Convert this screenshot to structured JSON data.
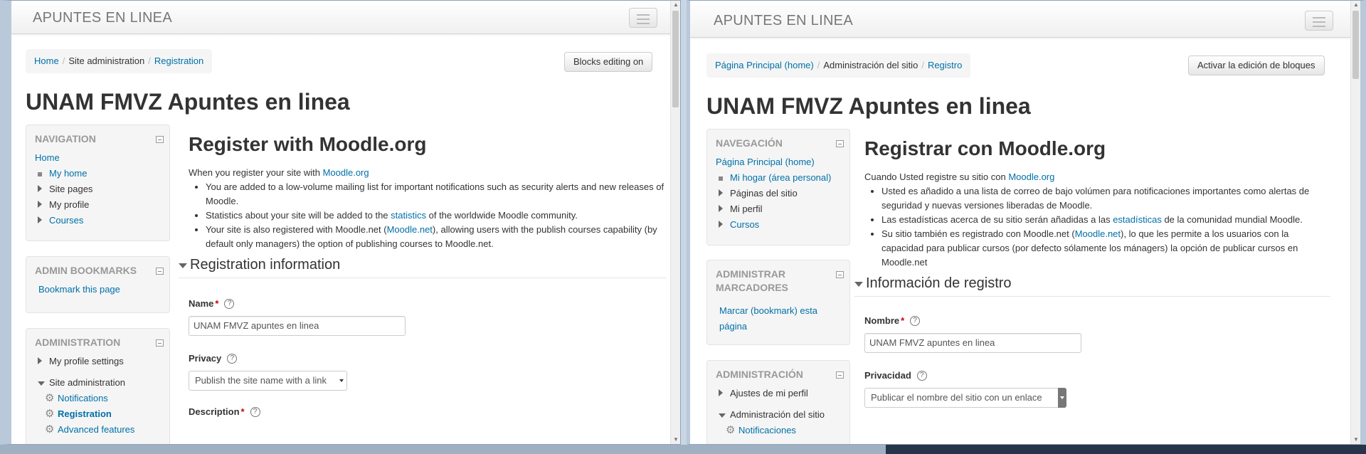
{
  "left": {
    "brand": "APUNTES EN LINEA",
    "breadcrumb": [
      "Home",
      "Site administration",
      "Registration"
    ],
    "edit_button": "Blocks editing on",
    "site_title": "UNAM FMVZ Apuntes en linea",
    "navigation": {
      "title": "NAVIGATION",
      "home": "Home",
      "items": [
        "My home",
        "Site pages",
        "My profile",
        "Courses"
      ]
    },
    "bookmarks": {
      "title": "ADMIN BOOKMARKS",
      "link": "Bookmark this page"
    },
    "administration": {
      "title": "ADMINISTRATION",
      "profile_settings": "My profile settings",
      "site_admin": "Site administration",
      "sub": [
        "Notifications",
        "Registration",
        "Advanced features"
      ]
    },
    "main": {
      "heading": "Register with Moodle.org",
      "intro_prefix": "When you register your site with ",
      "intro_link": "Moodle.org",
      "b1": "You are added to a low-volume mailing list for important notifications such as security alerts and new releases of Moodle.",
      "b2_pre": "Statistics about your site will be added to the ",
      "b2_link": "statistics",
      "b2_post": " of the worldwide Moodle community.",
      "b3_pre": "Your site is also registered with Moodle.net (",
      "b3_link": "Moodle.net",
      "b3_post": "), allowing users with the publish courses capability (by default only managers) the option of publishing courses to Moodle.net.",
      "legend": "Registration information",
      "name_label": "Name",
      "name_value": "UNAM FMVZ apuntes en linea",
      "privacy_label": "Privacy",
      "privacy_value": "Publish the site name with a link",
      "description_label": "Description"
    }
  },
  "right": {
    "brand": "APUNTES EN LINEA",
    "breadcrumb": [
      "Página Principal (home)",
      "Administración del sitio",
      "Registro"
    ],
    "edit_button": "Activar la edición de bloques",
    "site_title": "UNAM FMVZ Apuntes en linea",
    "navigation": {
      "title": "NAVEGACIÓN",
      "home": "Página Principal (home)",
      "items": [
        "Mi hogar (área personal)",
        "Páginas del sitio",
        "Mi perfil",
        "Cursos"
      ]
    },
    "bookmarks": {
      "title_1": "ADMINISTRAR",
      "title_2": "MARCADORES",
      "link_1": "Marcar (bookmark) esta",
      "link_2": "página"
    },
    "administration": {
      "title": "ADMINISTRACIÓN",
      "profile_settings": "Ajustes de mi perfil",
      "site_admin": "Administración del sitio",
      "sub": [
        "Notificaciones"
      ]
    },
    "main": {
      "heading": "Registrar con Moodle.org",
      "intro_prefix": "Cuando Usted registre su sitio con ",
      "intro_link": "Moodle.org",
      "b1": "Usted es añadido a una lista de correo de bajo volúmen para notificaciones importantes como alertas de seguridad y nuevas versiones liberadas de Moodle.",
      "b2_pre": "Las estadísticas acerca de su sitio serán añadidas a las ",
      "b2_link": "estadísticas",
      "b2_post": " de la comunidad mundial Moodle.",
      "b3_pre": "Su sitio también es registrado con Moodle.net (",
      "b3_link": "Moodle.net",
      "b3_post": "), lo que les permite a los usuarios con la capacidad para publicar cursos (por defecto sólamente los mánagers) la opción de publicar cursos en Moodle.net",
      "legend": "Información de registro",
      "name_label": "Nombre",
      "name_value": "UNAM FMVZ apuntes en linea",
      "privacy_label": "Privacidad",
      "privacy_value": "Publicar el nombre del sitio con un enlace"
    }
  }
}
